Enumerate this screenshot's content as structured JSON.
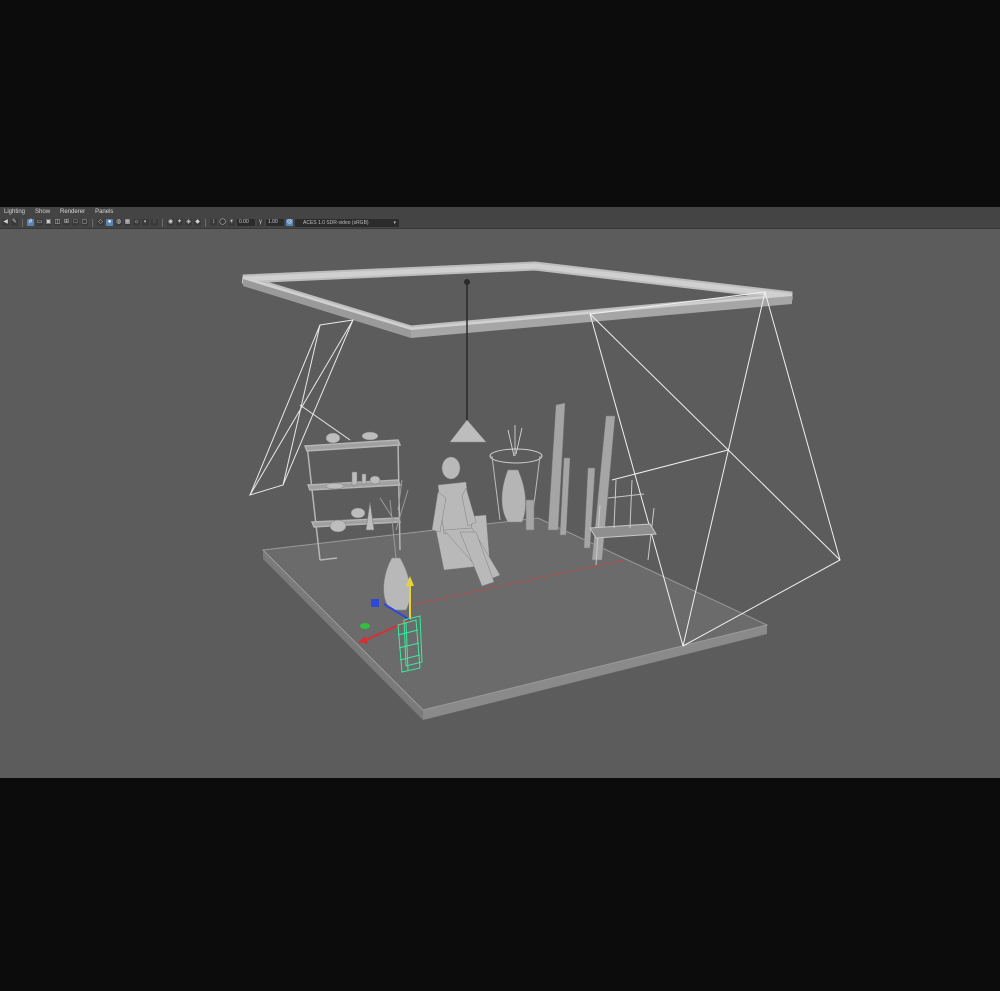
{
  "menu": {
    "items": [
      "Lighting",
      "Show",
      "Renderer",
      "Panels"
    ]
  },
  "toolbar": {
    "field_a": "0.00",
    "field_b": "1.00",
    "color_space": "ACES 1.0 SDR-video (sRGB)"
  },
  "viewport": {
    "camera_label": "persp",
    "background_color": "#5c5c5c",
    "selection_color": "#3ce8a0"
  }
}
